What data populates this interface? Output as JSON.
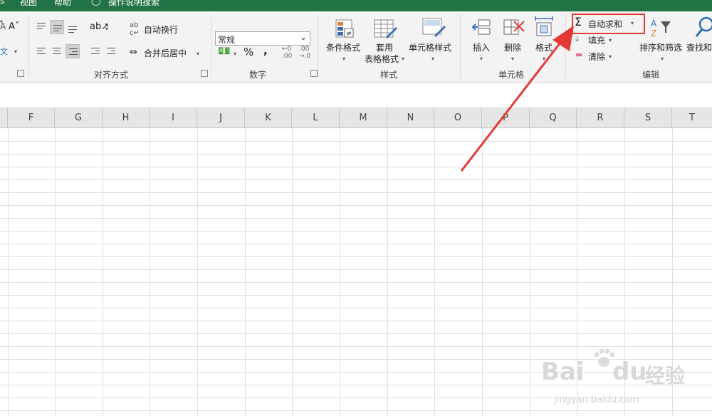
{
  "tabs": [
    "视图",
    "帮助",
    "操作说明搜索"
  ],
  "ribbon": {
    "alignment": {
      "wrap_text": "自动换行",
      "merge_center": "合并后居中",
      "group_label": "对齐方式"
    },
    "number": {
      "format_value": "常规",
      "percent": "%",
      "comma": ",",
      "inc_decimal": "←.0\n.00",
      "group_label": "数字"
    },
    "styles": {
      "conditional_format": "条件格式",
      "table_format_1": "套用",
      "table_format_2": "表格格式",
      "cell_styles": "单元格样式",
      "group_label": "样式"
    },
    "cells": {
      "insert": "插入",
      "delete": "删除",
      "format": "格式",
      "group_label": "单元格"
    },
    "editing": {
      "autosum": "自动求和",
      "fill": "填充",
      "clear": "清除",
      "sort_filter": "排序和筛选",
      "find_select": "查找和",
      "group_label": "编辑"
    }
  },
  "columns": [
    "F",
    "G",
    "H",
    "I",
    "J",
    "K",
    "L",
    "M",
    "N",
    "O",
    "P",
    "Q",
    "R",
    "S",
    "T"
  ],
  "watermark": {
    "brand": "Bai",
    "brand2": "du",
    "brand3": "经验",
    "url": "jingyan.baidu.com"
  },
  "colors": {
    "excel_green": "#217346",
    "highlight_red": "#e53935"
  }
}
